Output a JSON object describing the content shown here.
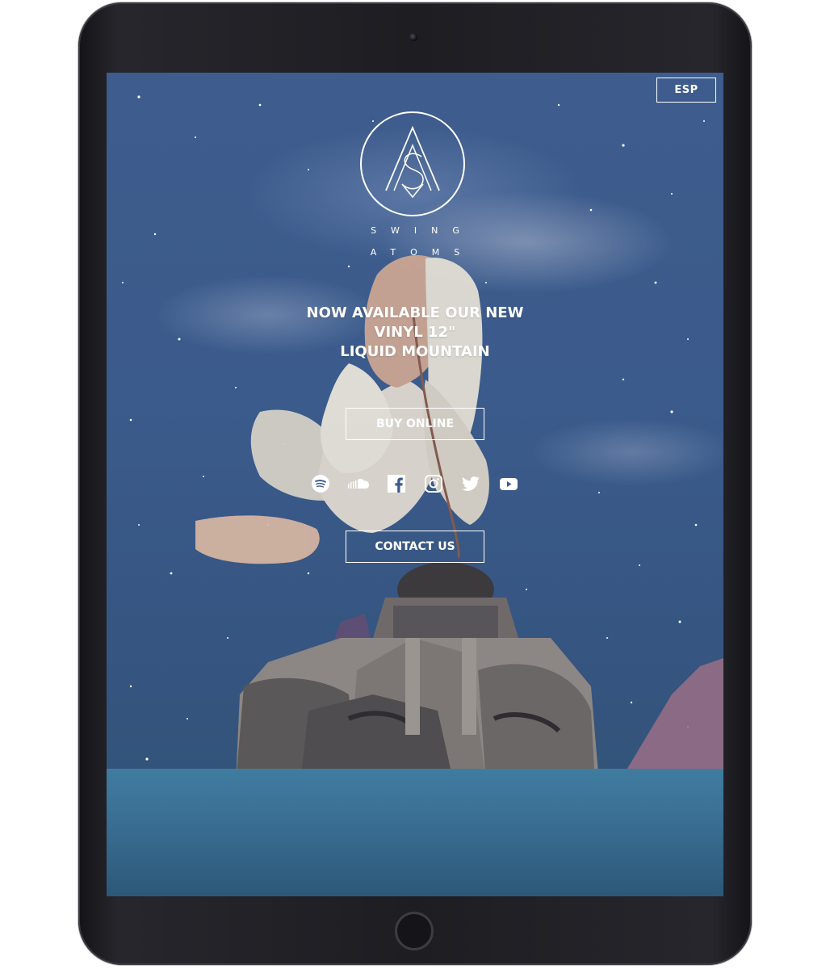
{
  "screen": {
    "lang_toggle": "ESP",
    "brand": {
      "line1": "SWING",
      "line2": "ATOMS"
    },
    "headline": [
      "NOW AVAILABLE OUR NEW",
      "VINYL 12\"",
      "LIQUID MOUNTAIN"
    ],
    "buy_label": "BUY ONLINE",
    "contact_label": "CONTACT US",
    "social_icons": [
      "spotify-icon",
      "soundcloud-icon",
      "facebook-icon",
      "instagram-icon",
      "twitter-icon",
      "youtube-icon"
    ]
  },
  "colors": {
    "sky": "#3b5b8c",
    "ground": "#3a6f93",
    "text": "#ffffff",
    "device_frame": "#1d1d22"
  }
}
